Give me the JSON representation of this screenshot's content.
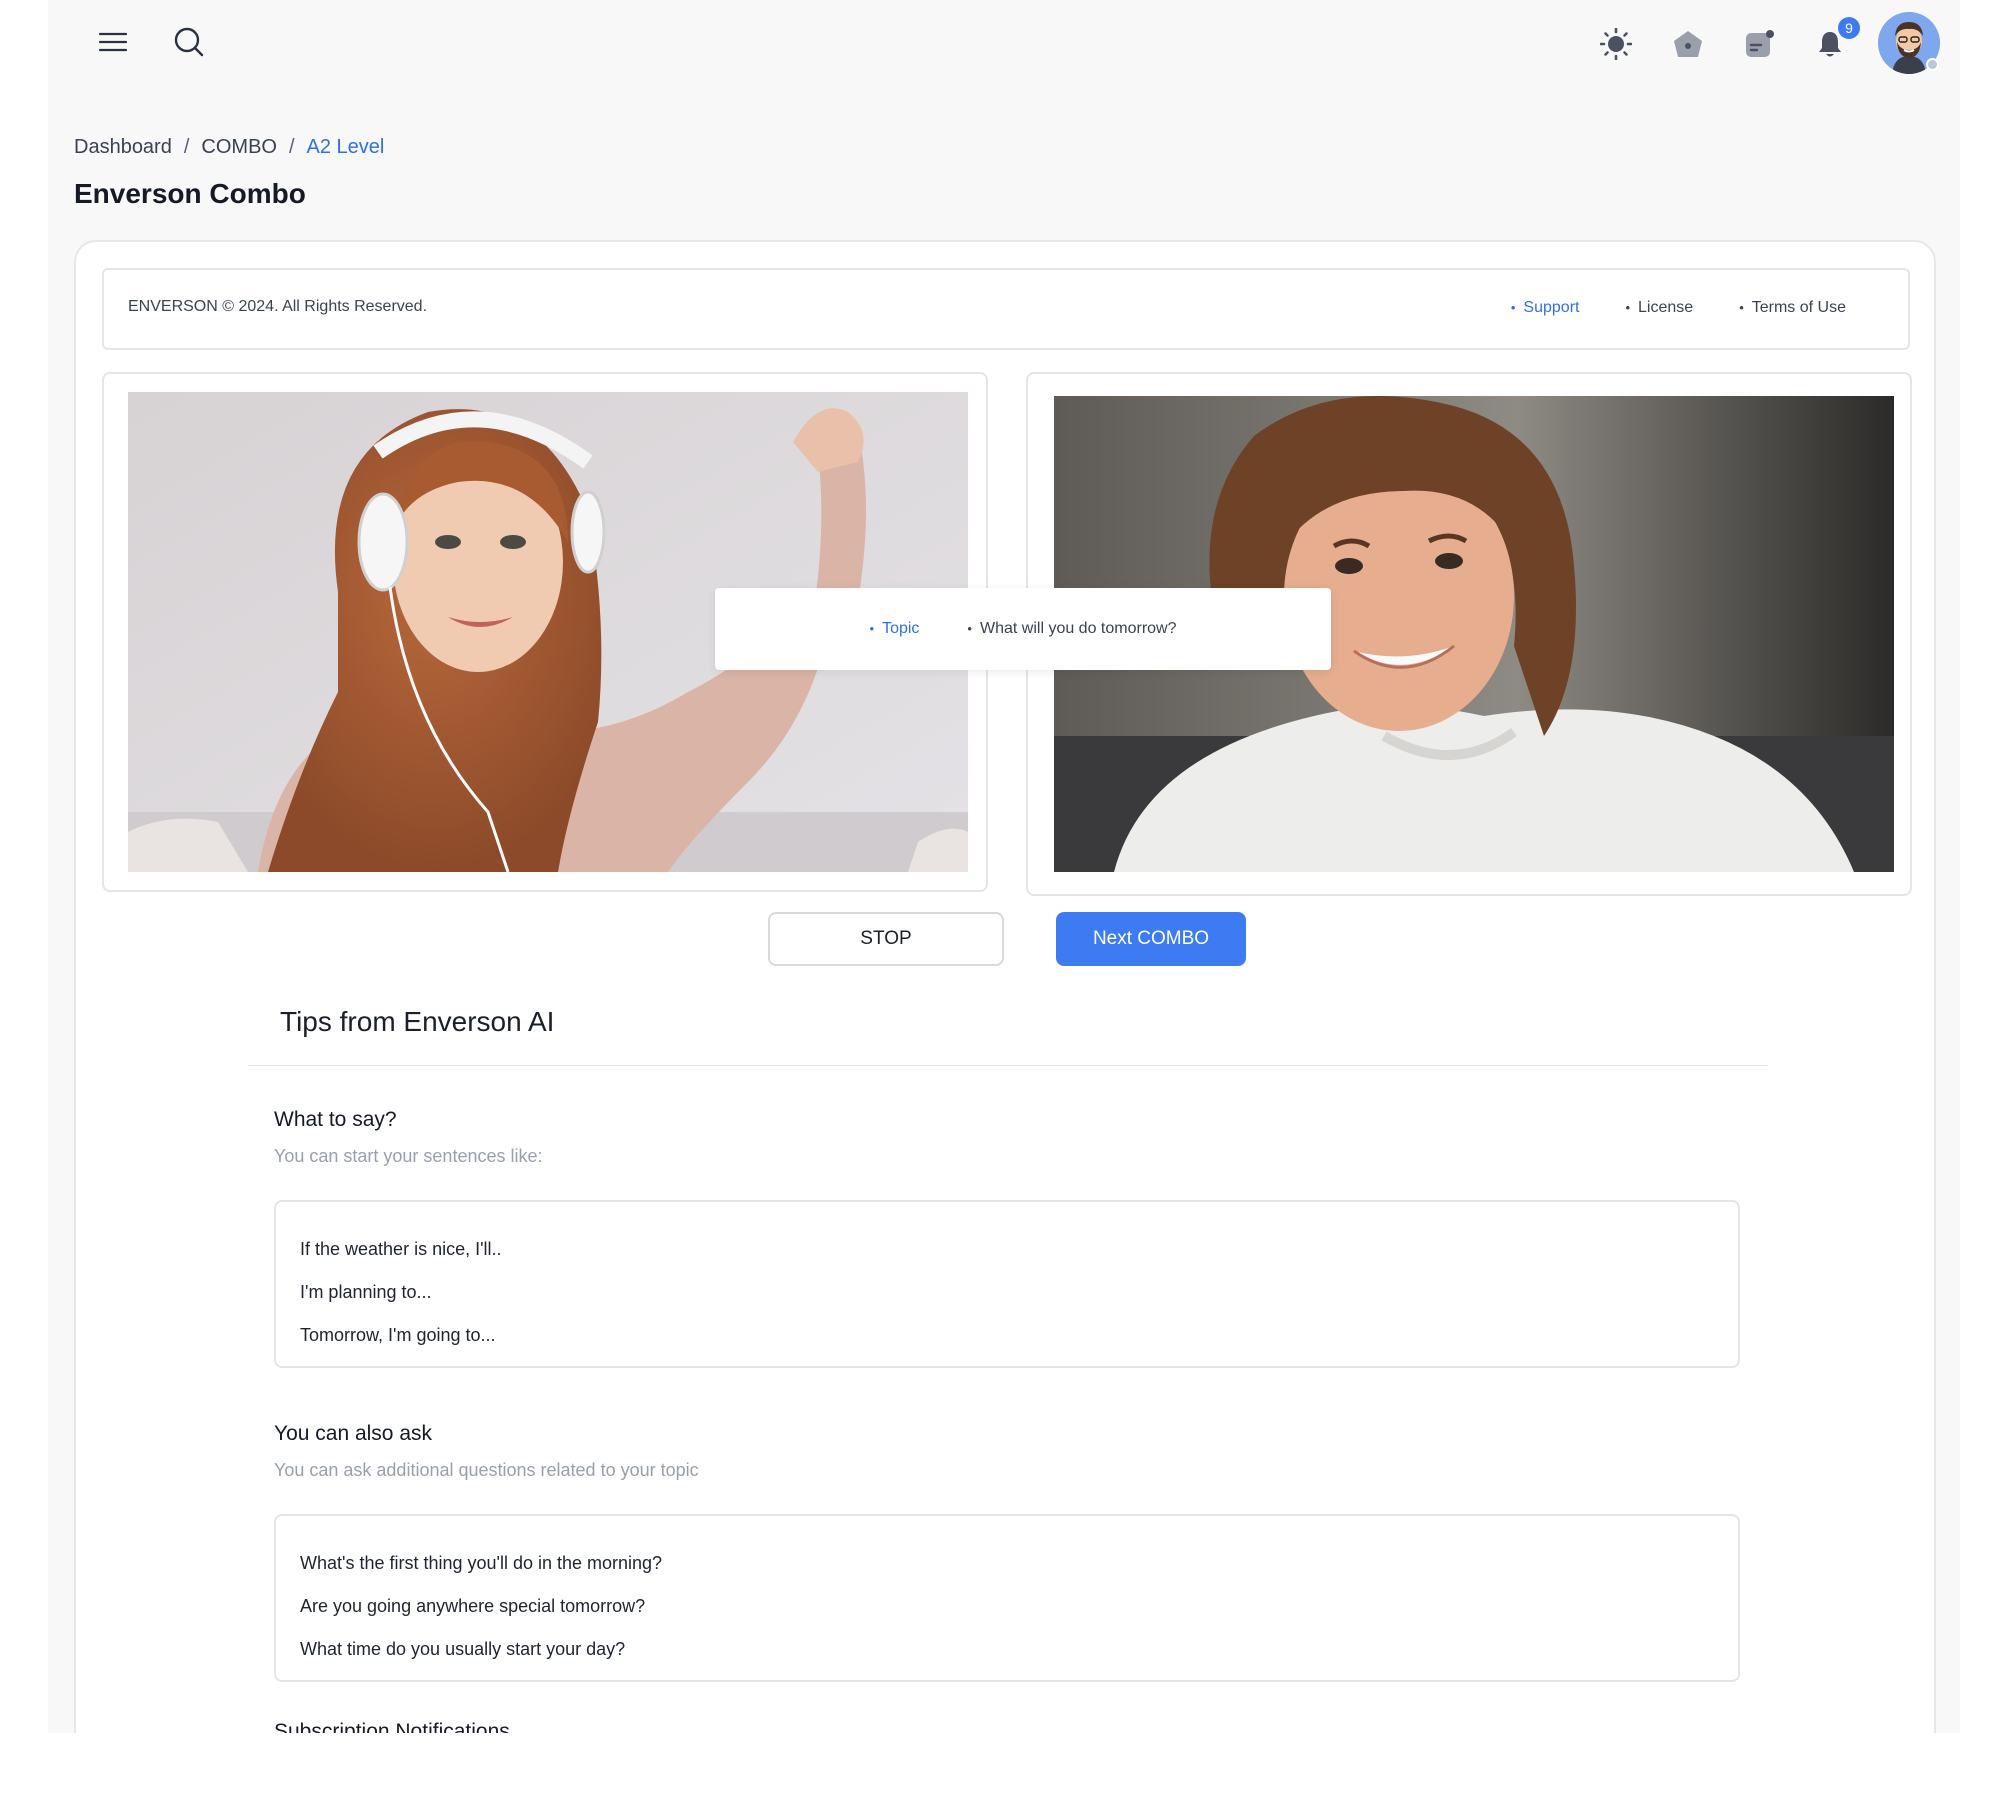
{
  "topbar": {
    "icons": [
      "menu-icon",
      "search-icon",
      "sun-icon",
      "home-icon",
      "chat-icon",
      "bell-icon"
    ],
    "notification_count": "9"
  },
  "breadcrumb": {
    "items": [
      "Dashboard",
      "COMBO",
      "A2 Level"
    ],
    "separator": "/"
  },
  "page": {
    "title": "Enverson Combo"
  },
  "footer": {
    "copyright": "ENVERSON © 2024. All Rights Reserved.",
    "links": [
      "Support",
      "License",
      "Terms of Use"
    ]
  },
  "topic": {
    "label": "Topic",
    "text": "What will you do tomorrow?"
  },
  "buttons": {
    "stop": "STOP",
    "next": "Next COMBO"
  },
  "tips": {
    "title": "Tips from Enverson AI",
    "what_to_say": {
      "title": "What to say?",
      "subtitle": "You can start your sentences like:",
      "phrases": [
        "If the weather is nice, I'll..",
        "I'm planning to...",
        "Tomorrow, I'm going to..."
      ]
    },
    "ask": {
      "title": "You can also ask",
      "subtitle": "You can ask additional questions related to your topic",
      "questions": [
        "What's the first thing you'll do in the morning?",
        "Are you going anywhere special tomorrow?",
        "What time do you usually start your day?"
      ]
    },
    "next_section_title": "Subscription Notifications"
  },
  "colors": {
    "accent": "#3d7bf2",
    "link": "#2f6fe8",
    "muted": "#9aa0ab"
  }
}
